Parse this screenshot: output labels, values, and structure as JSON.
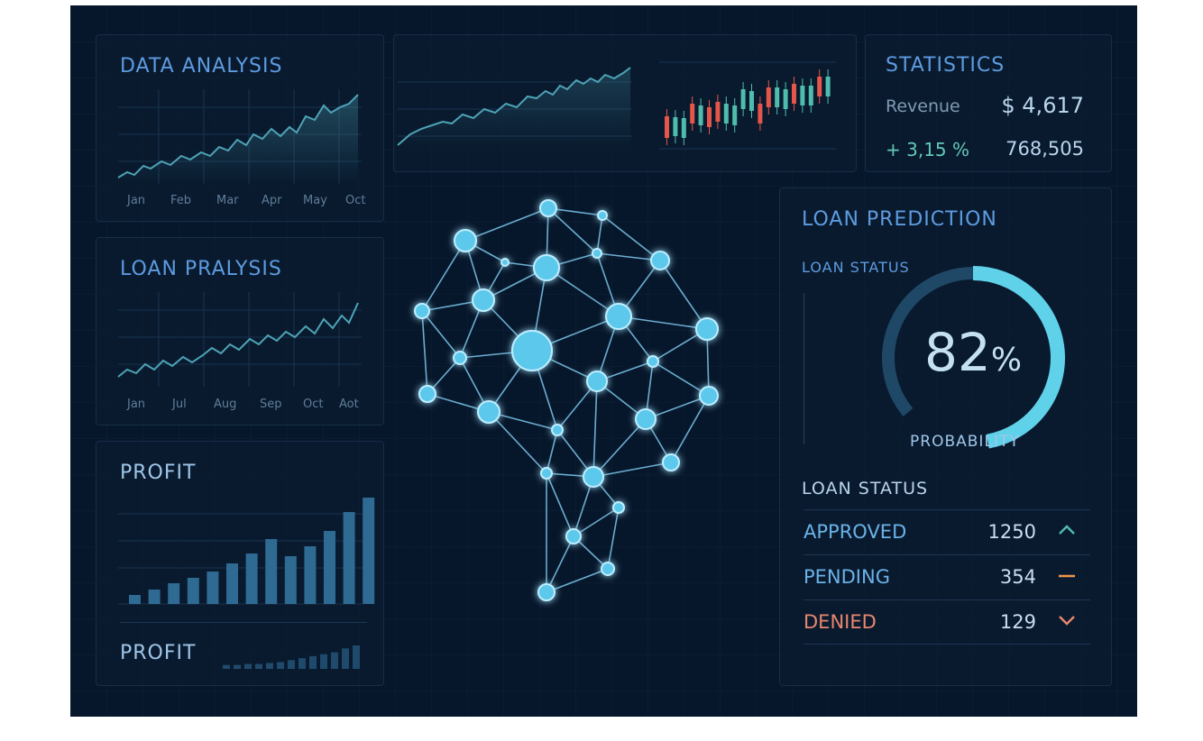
{
  "data_analysis": {
    "title": "DATA ANALYSIS",
    "months": [
      "Jan",
      "Feb",
      "Mar",
      "Apr",
      "May",
      "Oct"
    ]
  },
  "loan_analysis": {
    "title": "LOAN PRALYSIS",
    "months": [
      "Jan",
      "Jul",
      "Aug",
      "Sep",
      "Oct",
      "Aot"
    ]
  },
  "profit": {
    "title": "PROFIT",
    "footer_title": "PROFIT",
    "bars": [
      10,
      16,
      23,
      29,
      36,
      45,
      56,
      72,
      53,
      64,
      81,
      102,
      118
    ],
    "mini_bars": [
      4,
      4,
      5,
      5,
      6,
      7,
      9,
      11,
      13,
      15,
      17,
      21,
      24
    ]
  },
  "statistics": {
    "title": "STATISTICS",
    "revenue_label": "Revenue",
    "revenue_value": "$ 4,617",
    "change": "+ 3,15 %",
    "count": "768,505"
  },
  "loan_prediction": {
    "title": "LOAN PREDICTION",
    "status_label": "LOAN STATUS",
    "gauge_value": "82",
    "gauge_unit": "%",
    "gauge_fraction": 0.82,
    "gauge_caption": "PROBABILITY",
    "status_title": "LOAN STATUS",
    "rows": [
      {
        "label": "APPROVED",
        "count": "1250",
        "icon": "chevron-up-icon",
        "color": "#6bc4e8"
      },
      {
        "label": "PENDING",
        "count": "354",
        "icon": "dash-icon",
        "color": "#6bc4e8"
      },
      {
        "label": "DENIED",
        "count": "129",
        "icon": "chevron-down-icon",
        "color": "#e8876f"
      }
    ]
  },
  "colors": {
    "accent": "#5d9be0",
    "line": "#4ea3b6",
    "bar": "#2f6a93",
    "node": "#6fd4f2",
    "candle_up": "#4fbcae",
    "candle_down": "#e4564a",
    "gauge": "#5fd2ea"
  }
}
